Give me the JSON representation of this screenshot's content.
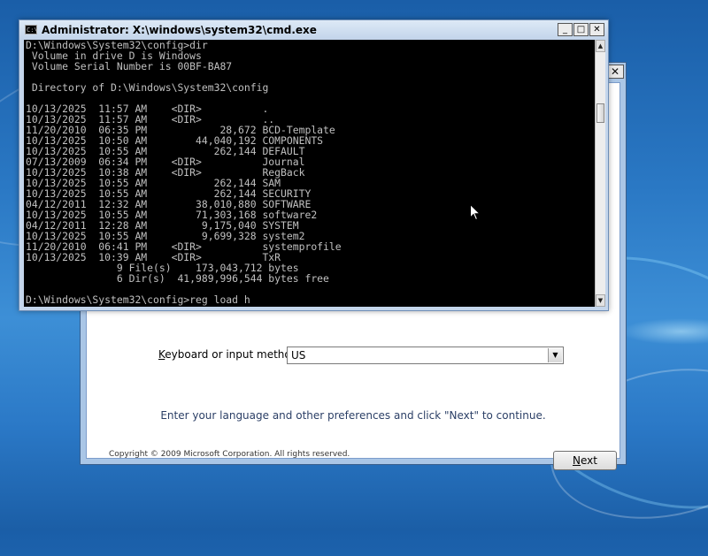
{
  "cmd": {
    "title": "Administrator: X:\\windows\\system32\\cmd.exe",
    "icon_text": "C:\\",
    "controls": {
      "minimize": "_",
      "maximize": "□",
      "close": "✕"
    },
    "lines": [
      "D:\\Windows\\System32\\config>dir",
      " Volume in drive D is Windows",
      " Volume Serial Number is 00BF-BA87",
      "",
      " Directory of D:\\Windows\\System32\\config",
      "",
      "10/13/2025  11:57 AM    <DIR>          .",
      "10/13/2025  11:57 AM    <DIR>          ..",
      "11/20/2010  06:35 PM            28,672 BCD-Template",
      "10/13/2025  10:50 AM        44,040,192 COMPONENTS",
      "10/13/2025  10:55 AM           262,144 DEFAULT",
      "07/13/2009  06:34 PM    <DIR>          Journal",
      "10/13/2025  10:38 AM    <DIR>          RegBack",
      "10/13/2025  10:55 AM           262,144 SAM",
      "10/13/2025  10:55 AM           262,144 SECURITY",
      "04/12/2011  12:32 AM        38,010,880 SOFTWARE",
      "10/13/2025  10:55 AM        71,303,168 software2",
      "04/12/2011  12:28 AM         9,175,040 SYSTEM",
      "10/13/2025  10:55 AM         9,699,328 system2",
      "11/20/2010  06:41 PM    <DIR>          systemprofile",
      "10/13/2025  10:39 AM    <DIR>          TxR",
      "               9 File(s)    173,043,712 bytes",
      "               6 Dir(s)  41,989,996,544 bytes free",
      "",
      "D:\\Windows\\System32\\config>reg load h"
    ]
  },
  "setup": {
    "close": "✕",
    "keyboard_label_accel": "K",
    "keyboard_label_rest": "eyboard or input method:",
    "keyboard_value": "US",
    "instruction": "Enter your language and other preferences and click \"Next\" to continue.",
    "copyright": "Copyright © 2009 Microsoft Corporation. All rights reserved.",
    "next_accel": "N",
    "next_rest": "ext"
  }
}
